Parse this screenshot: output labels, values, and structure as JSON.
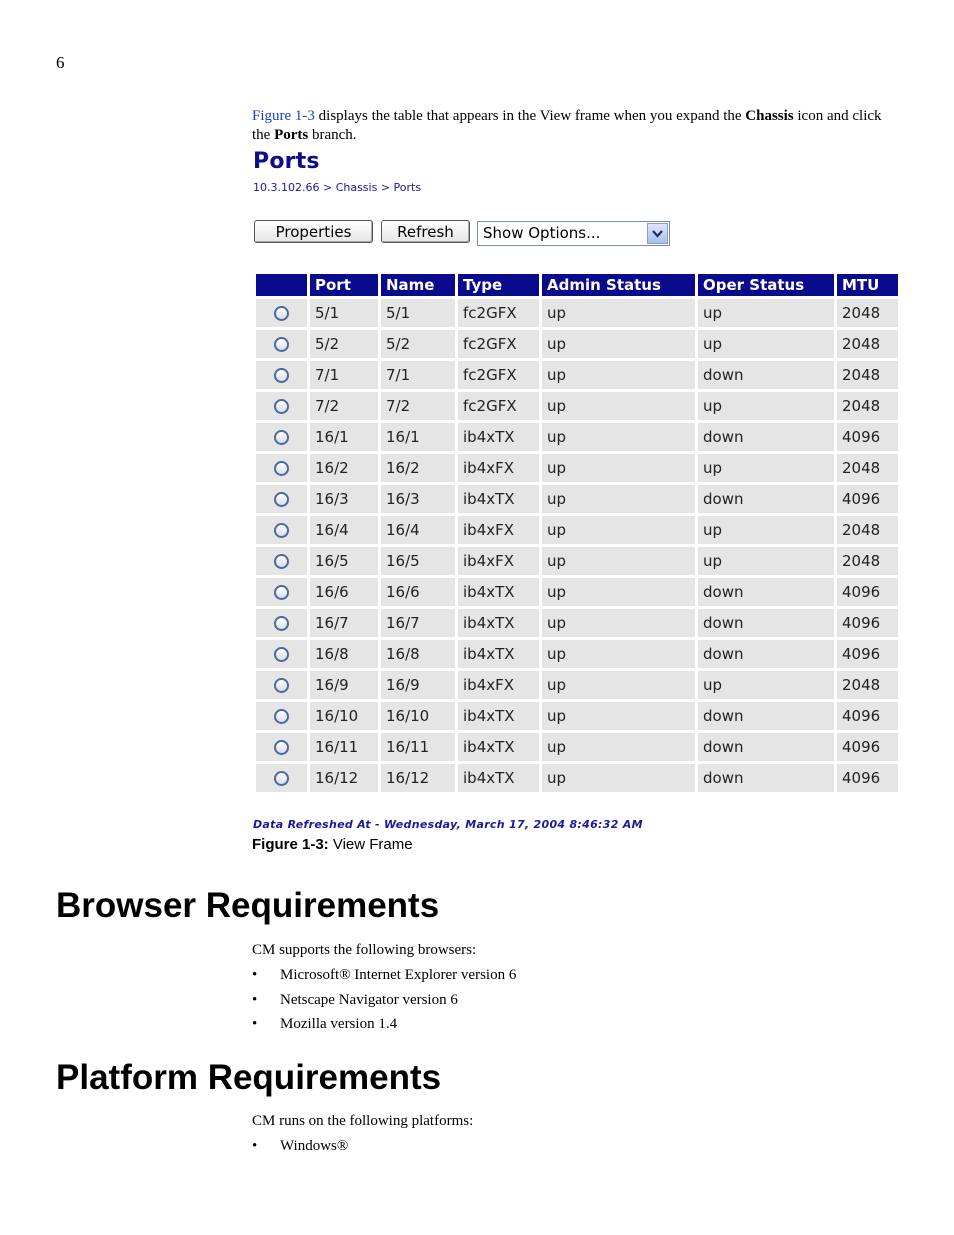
{
  "page_number": "6",
  "intro": {
    "link": "Figure 1-3",
    "t1": " displays the table that appears in the View frame when you expand the ",
    "b1": "Chassis",
    "t2": " icon and click the ",
    "b2": "Ports",
    "t3": " branch."
  },
  "figure": {
    "title": "Ports",
    "breadcrumb": "10.3.102.66 > Chassis > Ports",
    "buttons": {
      "properties": "Properties",
      "refresh": "Refresh"
    },
    "select": {
      "value": "Show Options..."
    },
    "columns": [
      "Port",
      "Name",
      "Type",
      "Admin Status",
      "Oper Status",
      "MTU"
    ],
    "rows": [
      [
        "5/1",
        "5/1",
        "fc2GFX",
        "up",
        "up",
        "2048"
      ],
      [
        "5/2",
        "5/2",
        "fc2GFX",
        "up",
        "up",
        "2048"
      ],
      [
        "7/1",
        "7/1",
        "fc2GFX",
        "up",
        "down",
        "2048"
      ],
      [
        "7/2",
        "7/2",
        "fc2GFX",
        "up",
        "up",
        "2048"
      ],
      [
        "16/1",
        "16/1",
        "ib4xTX",
        "up",
        "down",
        "4096"
      ],
      [
        "16/2",
        "16/2",
        "ib4xFX",
        "up",
        "up",
        "2048"
      ],
      [
        "16/3",
        "16/3",
        "ib4xTX",
        "up",
        "down",
        "4096"
      ],
      [
        "16/4",
        "16/4",
        "ib4xFX",
        "up",
        "up",
        "2048"
      ],
      [
        "16/5",
        "16/5",
        "ib4xFX",
        "up",
        "up",
        "2048"
      ],
      [
        "16/6",
        "16/6",
        "ib4xTX",
        "up",
        "down",
        "4096"
      ],
      [
        "16/7",
        "16/7",
        "ib4xTX",
        "up",
        "down",
        "4096"
      ],
      [
        "16/8",
        "16/8",
        "ib4xTX",
        "up",
        "down",
        "4096"
      ],
      [
        "16/9",
        "16/9",
        "ib4xFX",
        "up",
        "up",
        "2048"
      ],
      [
        "16/10",
        "16/10",
        "ib4xTX",
        "up",
        "down",
        "4096"
      ],
      [
        "16/11",
        "16/11",
        "ib4xTX",
        "up",
        "down",
        "4096"
      ],
      [
        "16/12",
        "16/12",
        "ib4xTX",
        "up",
        "down",
        "4096"
      ]
    ],
    "refreshed": "Data Refreshed At - Wednesday, March 17, 2004 8:46:32 AM",
    "caption_label": "Figure 1-3:",
    "caption_text": " View Frame"
  },
  "browser": {
    "heading": "Browser Requirements",
    "intro": "CM supports the following browsers:",
    "items": [
      "Microsoft® Internet Explorer version 6",
      "Netscape Navigator version 6",
      "Mozilla version 1.4"
    ]
  },
  "platform": {
    "heading": "Platform Requirements",
    "intro": "CM runs on the following platforms:",
    "items": [
      "Windows®"
    ]
  },
  "colors": {
    "header_bg": "#0a0a8c",
    "row_bg": "#e5e5e5",
    "link": "#1a3fc8"
  }
}
